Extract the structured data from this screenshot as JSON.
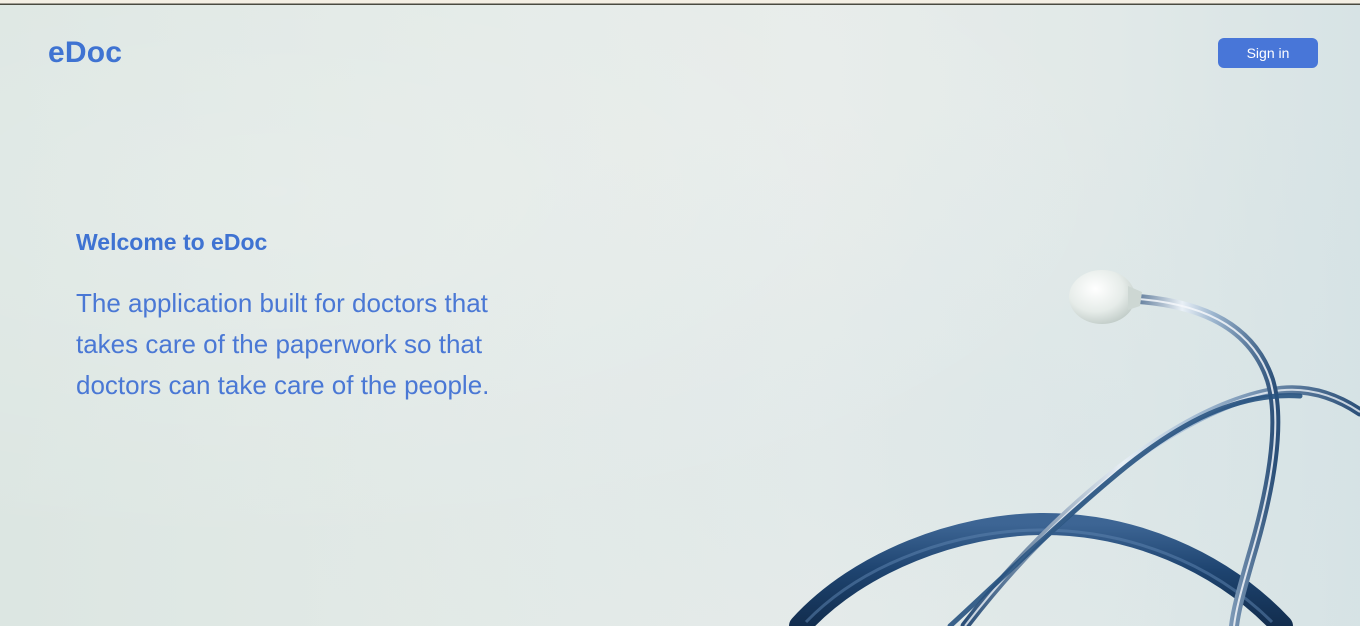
{
  "header": {
    "brand": "eDoc",
    "signin_label": "Sign in"
  },
  "hero": {
    "welcome": "Welcome to eDoc",
    "tagline": "The application built for doctors that takes care of the paperwork so that doctors can take care of the people."
  },
  "colors": {
    "brand": "#3f73d2",
    "button": "#4876d8",
    "stethoscope_tube": "#1d3f68"
  },
  "icons": {
    "hero_image": "stethoscope-illustration"
  }
}
